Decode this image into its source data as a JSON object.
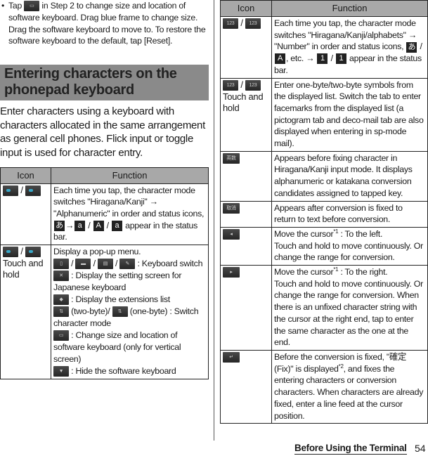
{
  "note": {
    "bullet": "•",
    "text_before_icon": "Tap",
    "icon": "resize-keyboard-icon",
    "text_after_icon": "in Step 2 to change size and location of software keyboard. Drag blue frame to change size. Drag the software keyboard to move to. To restore the software keyboard to the default, tap [Reset]."
  },
  "section": {
    "heading": "Entering characters on the phonepad keyboard",
    "intro": "Enter characters using a keyboard with characters allocated in the same arrangement as general cell phones. Flick input or toggle input is used for character entry."
  },
  "left_table": {
    "headers": [
      "Icon",
      "Function"
    ],
    "rows": [
      {
        "icons": [
          "mode-hiragana-icon",
          "mode-alpha-icon"
        ],
        "icon_sep": "/",
        "icon_caption": "",
        "text_parts": [
          "Each time you tap, the character mode switches \"Hiragana/Kanji\" → \"Alphanumeric\" in order and status icons,",
          "appear in the status bar."
        ],
        "status_icons": [
          "あ",
          "a",
          "A",
          "a"
        ]
      },
      {
        "icons": [
          "mode-hiragana-icon",
          "mode-alpha-icon"
        ],
        "icon_sep": "/",
        "icon_caption": "Touch and hold",
        "lines": [
          "Display a pop-up menu.",
          ": Keyboard switch",
          ": Display the setting screen for Japanese keyboard",
          ": Display the extensions list",
          "(two-byte)/",
          "(one-byte) : Switch character mode",
          ": Change size and location of software keyboard (only for vertical screen)",
          ": Hide the software keyboard"
        ]
      }
    ]
  },
  "right_table": {
    "headers": [
      "Icon",
      "Function"
    ],
    "rows": [
      {
        "icons": [
          "number-mode-icon",
          "number-mode-icon"
        ],
        "icon_sep": "/",
        "icon_caption": "",
        "text_parts": [
          "Each time you tap, the character mode switches \"Hiragana/Kanji/alphabets\" → \"Number\" in order and status icons,",
          ", etc. →",
          "appear in the status bar."
        ],
        "status_icons": [
          "あ",
          "A",
          "1",
          "1"
        ]
      },
      {
        "icons": [
          "number-mode-icon",
          "number-mode-icon"
        ],
        "icon_sep": "/",
        "icon_caption": "Touch and hold",
        "text": "Enter one-byte/two-byte symbols from the displayed list. Switch the tab to enter facemarks from the displayed list (a pictogram tab and deco-mail tab are also displayed when entering in sp-mode mail)."
      },
      {
        "icon": "alphanumeric-candidates-icon",
        "text": "Appears before fixing character in Hiragana/Kanji input mode. It displays alphanumeric or katakana conversion candidates assigned to tapped key."
      },
      {
        "icon": "undo-conversion-icon",
        "text": "Appears after conversion is fixed to return to text before conversion."
      },
      {
        "icon": "cursor-left-icon",
        "glyph": "◂",
        "lines": [
          "Move the cursor",
          "*1",
          " : To the left.",
          "Touch and hold to move continuously. Or change the range for conversion."
        ]
      },
      {
        "icon": "cursor-right-icon",
        "glyph": "▸",
        "lines": [
          "Move the cursor",
          "*1",
          " : To the right.",
          "Touch and hold to move continuously. Or change the range for conversion. When there is an unfixed character string with the cursor at the right end, tap to enter the same character as the one at the end."
        ]
      },
      {
        "icon": "enter-icon",
        "glyph": "↵",
        "parts": [
          "Before the conversion is fixed, \"確定 (Fix)\" is displayed",
          "*2",
          ", and fixes the entering characters or conversion characters. When characters are already fixed, enter a line feed at the cursor position."
        ]
      }
    ]
  },
  "footer": {
    "section_title": "Before Using the Terminal",
    "page_number": "54"
  }
}
